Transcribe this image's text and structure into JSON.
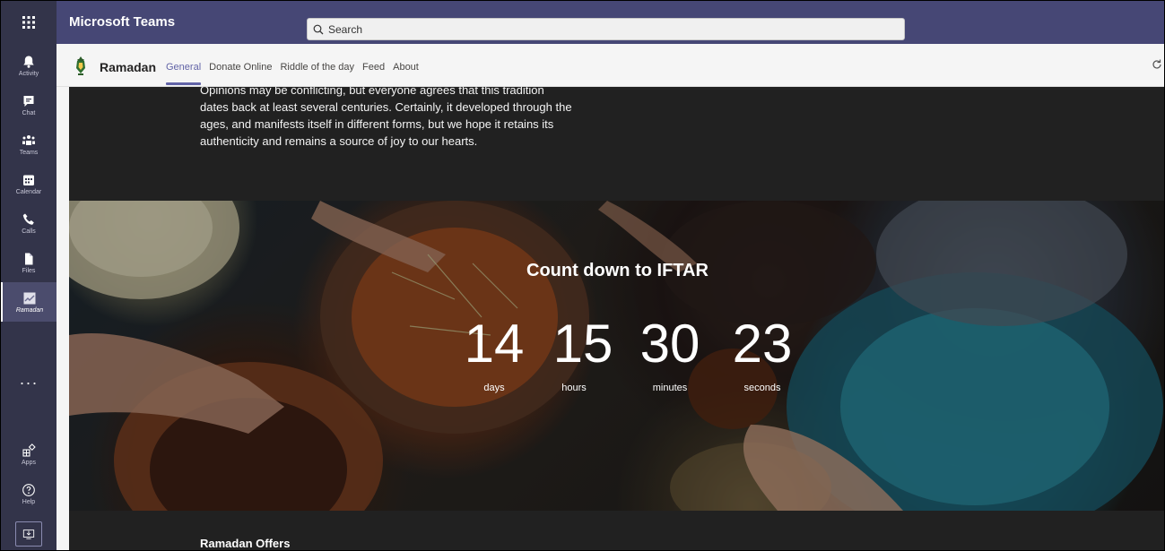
{
  "app": {
    "title": "Microsoft Teams"
  },
  "search": {
    "placeholder": "Search"
  },
  "rail": {
    "items": [
      {
        "label": "Activity",
        "icon": "bell-icon"
      },
      {
        "label": "Chat",
        "icon": "chat-icon"
      },
      {
        "label": "Teams",
        "icon": "teams-icon"
      },
      {
        "label": "Calendar",
        "icon": "calendar-icon"
      },
      {
        "label": "Calls",
        "icon": "phone-icon"
      },
      {
        "label": "Files",
        "icon": "file-icon"
      },
      {
        "label": "Ramadan",
        "icon": "ramadan-app-icon"
      }
    ],
    "more": "···",
    "bottom": [
      {
        "label": "Apps",
        "icon": "apps-icon"
      },
      {
        "label": "Help",
        "icon": "help-icon"
      }
    ]
  },
  "tab_header": {
    "app_name": "Ramadan",
    "tabs": [
      "General",
      "Donate Online",
      "Riddle of the day",
      "Feed",
      "About"
    ],
    "active_tab": "General"
  },
  "intro": {
    "lines": [
      "Opinions may be conflicting, but everyone agrees that this tradition",
      "dates back at least several centuries. Certainly, it developed through the",
      "ages, and manifests itself in different forms, but we hope it retains its",
      "authenticity and remains a source of joy to our hearts."
    ]
  },
  "countdown": {
    "title": "Count down to IFTAR",
    "units": [
      {
        "value": "14",
        "label": "days"
      },
      {
        "value": "15",
        "label": "hours"
      },
      {
        "value": "30",
        "label": "minutes"
      },
      {
        "value": "23",
        "label": "seconds"
      }
    ]
  },
  "offers": {
    "title": "Ramadan Offers"
  }
}
